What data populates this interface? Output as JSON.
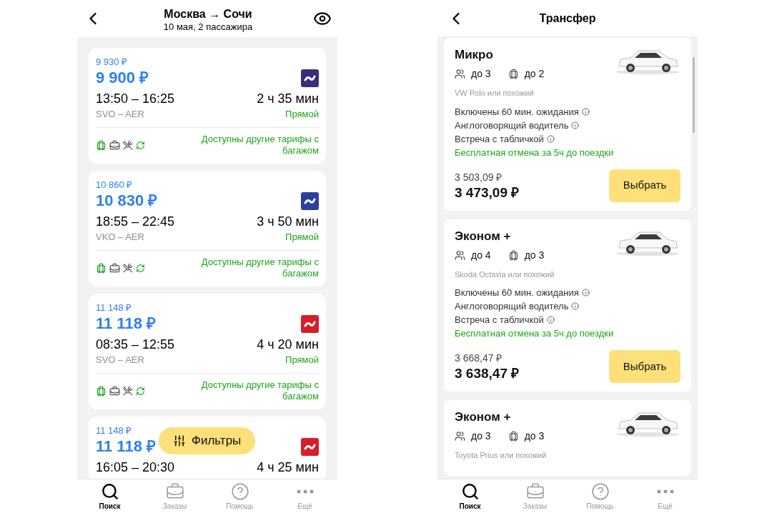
{
  "flights_screen": {
    "header": {
      "title": "Москва → Сочи",
      "subtitle": "10 мая, 2 пассажира"
    },
    "flights": [
      {
        "old_price": "9 930 ₽",
        "price": "9 900 ₽",
        "color": "#3a2d7d",
        "time": "13:50 – 16:25",
        "duration": "2 ч 35 мин",
        "route": "SVO – AER",
        "stops": "Прямой",
        "tariffs": "Доступны другие тарифы с багажом"
      },
      {
        "old_price": "10 860 ₽",
        "price": "10 830 ₽",
        "color": "#2b3f9e",
        "time": "18:55 – 22:45",
        "duration": "3 ч 50 мин",
        "route": "VKO – AER",
        "stops": "Прямой",
        "tariffs": "Доступны другие тарифы с багажом"
      },
      {
        "old_price": "11 148 ₽",
        "price": "11 118 ₽",
        "color": "#d81e2a",
        "time": "08:35 – 12:55",
        "duration": "4 ч 20 мин",
        "route": "SVO – AER",
        "stops": "Прямой",
        "tariffs": "Доступны другие тарифы с багажом"
      },
      {
        "old_price": "11 148 ₽",
        "price": "11 118 ₽",
        "color": "#d81e2a",
        "time": "16:05 – 20:30",
        "duration": "4 ч 25 мин"
      }
    ],
    "filter_button": "Фильтры",
    "tab_bar": [
      {
        "label": "Поиск",
        "selected": true
      },
      {
        "label": "Заказы",
        "selected": false
      },
      {
        "label": "Помощь",
        "selected": false
      },
      {
        "label": "Ещё",
        "selected": false
      }
    ]
  },
  "transfer_screen": {
    "header": {
      "title": "Трансфер"
    },
    "transfers": [
      {
        "class": "Микро",
        "passengers": "до 3",
        "bags": "до 2",
        "model": "VW Polo или похожий",
        "features": [
          "Включены 60 мин. ожидания",
          "Англоговорящий водитель",
          "Встреча с табличкой"
        ],
        "cancellation": "Бесплатная отмена за 5ч до поездки",
        "old_price": "3 503,09 ₽",
        "price": "3 473,09 ₽",
        "button": "Выбрать"
      },
      {
        "class": "Эконом +",
        "passengers": "до 4",
        "bags": "до 3",
        "model": "Skoda Octavia или похожий",
        "features": [
          "Включены 60 мин. ожидания",
          "Англоговорящий водитель",
          "Встреча с табличкой"
        ],
        "cancellation": "Бесплатная отмена за 5ч до поездки",
        "old_price": "3 668,47 ₽",
        "price": "3 638,47 ₽",
        "button": "Выбрать"
      },
      {
        "class": "Эконом +",
        "passengers": "до 3",
        "bags": "до 3",
        "model": "Toyota Prius или похожий"
      }
    ],
    "tab_bar": [
      {
        "label": "Поиск",
        "selected": true
      },
      {
        "label": "Заказы",
        "selected": false
      },
      {
        "label": "Помощь",
        "selected": false
      },
      {
        "label": "Ещё",
        "selected": false
      }
    ]
  }
}
